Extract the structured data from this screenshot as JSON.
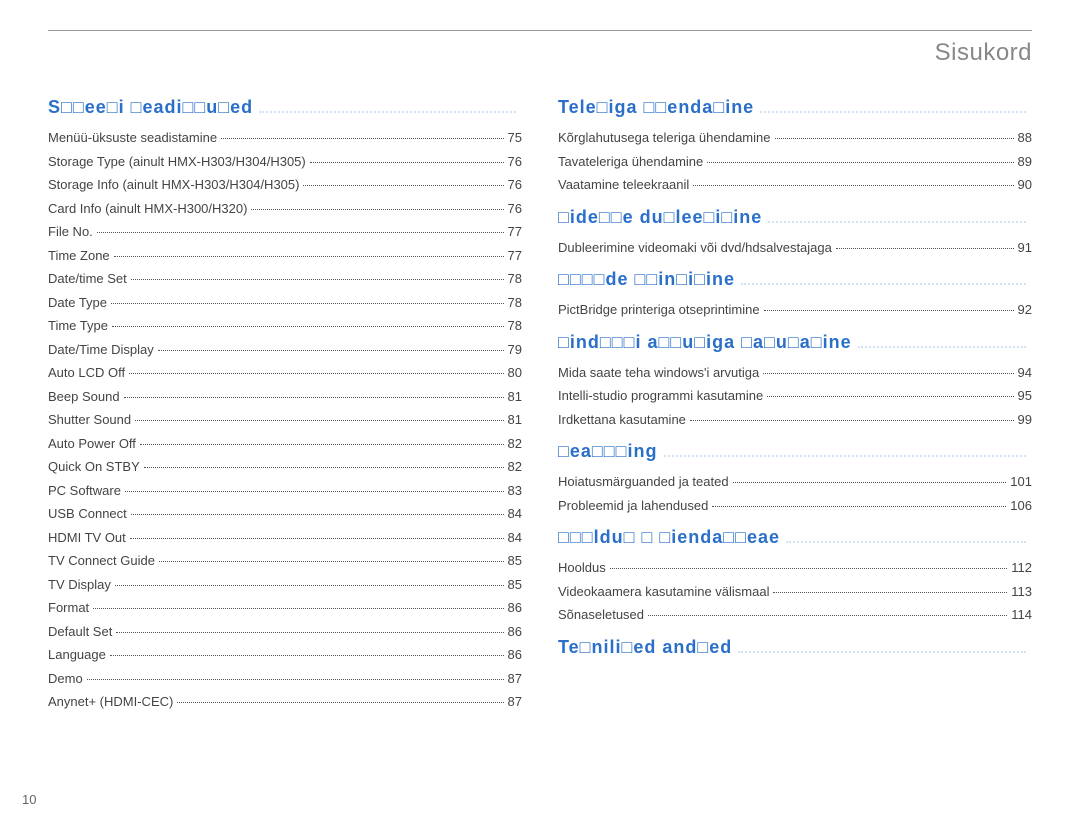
{
  "title": "Sisukord",
  "page_number": "10",
  "left": {
    "section": {
      "label": "S□□ee□i □eadi□□u□ed",
      "page": ""
    },
    "items": [
      {
        "label": "Menüü-üksuste seadistamine",
        "page": "75"
      },
      {
        "label": "Storage Type (ainult HMX-H303/H304/H305)",
        "page": "76"
      },
      {
        "label": "Storage Info (ainult HMX-H303/H304/H305)",
        "page": "76"
      },
      {
        "label": "Card Info (ainult HMX-H300/H320)",
        "page": "76"
      },
      {
        "label": "File No.",
        "page": "77"
      },
      {
        "label": "Time Zone",
        "page": "77"
      },
      {
        "label": "Date/time Set",
        "page": "78"
      },
      {
        "label": "Date Type",
        "page": "78"
      },
      {
        "label": "Time Type",
        "page": "78"
      },
      {
        "label": "Date/Time Display",
        "page": "79"
      },
      {
        "label": "Auto LCD Off",
        "page": "80"
      },
      {
        "label": "Beep Sound",
        "page": "81"
      },
      {
        "label": "Shutter Sound",
        "page": "81"
      },
      {
        "label": "Auto Power Off",
        "page": "82"
      },
      {
        "label": "Quick On STBY",
        "page": "82"
      },
      {
        "label": "PC Software",
        "page": "83"
      },
      {
        "label": "USB Connect",
        "page": "84"
      },
      {
        "label": "HDMI TV Out",
        "page": "84"
      },
      {
        "label": "TV Connect Guide",
        "page": "85"
      },
      {
        "label": "TV Display",
        "page": "85"
      },
      {
        "label": "Format",
        "page": "86"
      },
      {
        "label": "Default Set",
        "page": "86"
      },
      {
        "label": "Language",
        "page": "86"
      },
      {
        "label": "Demo",
        "page": "87"
      },
      {
        "label": "Anynet+ (HDMI-CEC)",
        "page": "87"
      }
    ]
  },
  "right": [
    {
      "section": {
        "label": "Tele□iga □□enda□ine",
        "page": ""
      },
      "items": [
        {
          "label": "Kõrglahutusega teleriga ühendamine",
          "page": "88"
        },
        {
          "label": "Tavateleriga ühendamine",
          "page": "89"
        },
        {
          "label": "Vaatamine teleekraanil",
          "page": "90"
        }
      ]
    },
    {
      "section": {
        "label": "□ide□□e du□lee□i□ine",
        "page": ""
      },
      "items": [
        {
          "label": "Dubleerimine videomaki või dvd/hdsalvestajaga",
          "page": "91"
        }
      ]
    },
    {
      "section": {
        "label": "□□□□de □□in□i□ine",
        "page": ""
      },
      "items": [
        {
          "label": "PictBridge printeriga otseprintimine",
          "page": "92"
        }
      ]
    },
    {
      "section": {
        "label": "□ind□□□i a□□u□iga □a□u□a□ine",
        "page": ""
      },
      "items": [
        {
          "label": "Mida saate teha windows'i arvutiga",
          "page": "94"
        },
        {
          "label": "Intelli-studio programmi kasutamine",
          "page": "95"
        },
        {
          "label": "Irdkettana kasutamine",
          "page": "99"
        }
      ]
    },
    {
      "section": {
        "label": "□ea□□□ing",
        "page": ""
      },
      "items": [
        {
          "label": "Hoiatusmärguanded ja teated",
          "page": "101"
        },
        {
          "label": "Probleemid ja lahendused",
          "page": "106"
        }
      ]
    },
    {
      "section": {
        "label": "□□□ldu□ □ □ienda□□eae",
        "page": ""
      },
      "items": [
        {
          "label": "Hooldus",
          "page": "112"
        },
        {
          "label": "Videokaamera kasutamine välismaal",
          "page": "113"
        },
        {
          "label": "Sõnaseletused",
          "page": "114"
        }
      ]
    },
    {
      "section": {
        "label": "Te□nili□ed and□ed",
        "page": ""
      },
      "items": []
    }
  ]
}
